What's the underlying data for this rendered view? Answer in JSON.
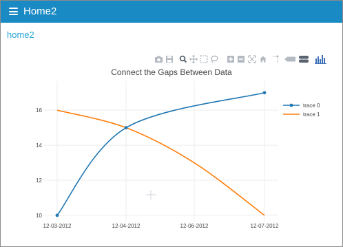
{
  "app": {
    "title": "Home2"
  },
  "page": {
    "heading": "home2"
  },
  "modebar": {
    "icons": [
      "camera-icon",
      "save-icon",
      "zoom-icon",
      "pan-icon",
      "box-select-icon",
      "lasso-icon",
      "zoom-in-icon",
      "zoom-out-icon",
      "autoscale-icon",
      "home-icon",
      "spike-lines-icon",
      "hover-closest-icon",
      "hover-compare-icon",
      "plotly-logo-icon"
    ]
  },
  "chart_data": {
    "type": "line",
    "title": "Connect the Gaps Between Data",
    "x": [
      "12-03-2012",
      "12-04-2012",
      "12-06-2012",
      "12-07-2012"
    ],
    "x_ticks": [
      "12-03-2012",
      "12-04-2012",
      "12-06-2012",
      "12-07-2012"
    ],
    "y_ticks": [
      10,
      12,
      14,
      16
    ],
    "ylim": [
      9.8,
      17.5
    ],
    "grid": true,
    "legend_position": "top-right",
    "series": [
      {
        "name": "trace 0",
        "color": "#1f77b4",
        "mode": "lines+markers",
        "shape": "spline",
        "y": [
          10,
          15,
          null,
          17
        ]
      },
      {
        "name": "trace 1",
        "color": "#ff7f0e",
        "mode": "lines",
        "shape": "spline",
        "y": [
          16,
          15,
          13,
          10
        ]
      }
    ]
  }
}
